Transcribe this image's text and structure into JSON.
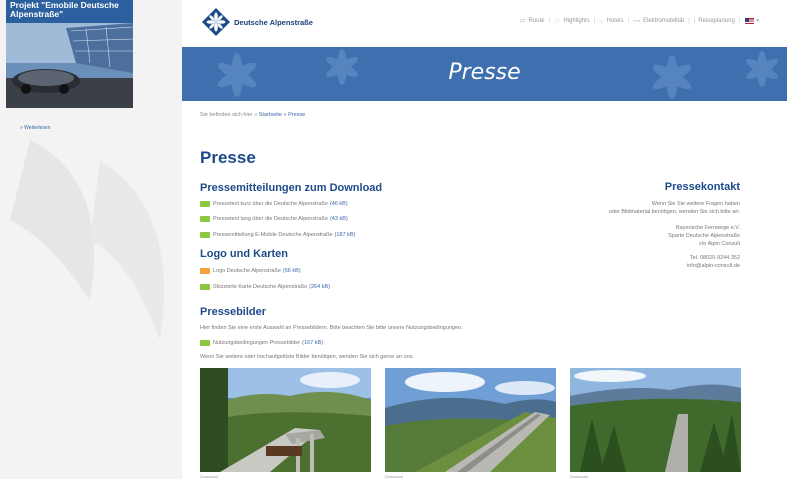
{
  "sidebar": {
    "promo_title": "Projekt \"Emobile Deutsche Alpenstraße\"",
    "read_more": "» Weiterlesen"
  },
  "header": {
    "logo_text": "Deutsche Alpenstraße",
    "nav": [
      {
        "label": "Route",
        "icon": "route-icon"
      },
      {
        "label": "Highlights",
        "icon": "star-icon"
      },
      {
        "label": "Hotels",
        "icon": "hotel-icon"
      },
      {
        "label": "Elektromobilität",
        "icon": "car-icon"
      },
      {
        "label": "Reiseplanung",
        "icon": "info-icon"
      }
    ],
    "language": "english-flag-icon"
  },
  "banner": {
    "title": "Presse"
  },
  "breadcrumb": {
    "prefix": "Sie befinden sich hier »",
    "link": "Startseite",
    "current": "» Presse"
  },
  "page": {
    "title": "Presse",
    "downloads_heading": "Pressemitteilungen zum Download",
    "downloads": [
      {
        "label": "Pressetext kurz über die Deutsche Alpenstraße",
        "size": "(46 kB)"
      },
      {
        "label": "Pressetext lang über die Deutsche Alpenstraße",
        "size": "(43 kB)"
      },
      {
        "label": "Pressemitteilung E-Mobile Deutsche Alpenstraße",
        "size": "(187 kB)"
      }
    ],
    "logo_heading": "Logo und Karten",
    "logo_items": [
      {
        "label": "Logo Deutsche Alpenstraße",
        "size": "(66 kB)",
        "tag": "orange"
      },
      {
        "label": "Skizzierte Karte Deutsche Alpenstraße",
        "size": "(264 kB)",
        "tag": "green"
      }
    ],
    "images_heading": "Pressebilder",
    "images_intro": "Hier finden Sie eine erste Auswahl an Pressebildern. Bitte beachten Sie bitte unsere Nutzungsbedingungen.",
    "terms_label": "Nutzungsbedingungen Pressebilder",
    "terms_size": "(167 kB)",
    "images_more": "Wenn Sie weitere oder hochaufgelöste Bilder benötigen, wenden Sie sich gerne an uns.",
    "photos": [
      {
        "caption": "Download",
        "icon": "bridge-photo"
      },
      {
        "caption": "Download",
        "icon": "road-photo"
      },
      {
        "caption": "Download",
        "icon": "forest-photo"
      }
    ]
  },
  "contact": {
    "heading": "Pressekontakt",
    "intro_1": "Wenn Sie Sie weitere Fragen haben",
    "intro_2": "oder Bildmaterial benötigen, wenden Sie sich bitte an:",
    "org_1": "Bayerische Fernwege e.V.",
    "org_2": "Sparte Deutsche Alpenstraße",
    "org_3": "c/o Alpin Consult",
    "phone": "Tel. 08025-9244 352",
    "email": "info@alpin-consult.de"
  },
  "colors": {
    "brand_blue": "#1e4a8a",
    "banner_blue": "#3e6fae",
    "tag_green": "#8dc63f",
    "tag_orange": "#f4a23a"
  }
}
